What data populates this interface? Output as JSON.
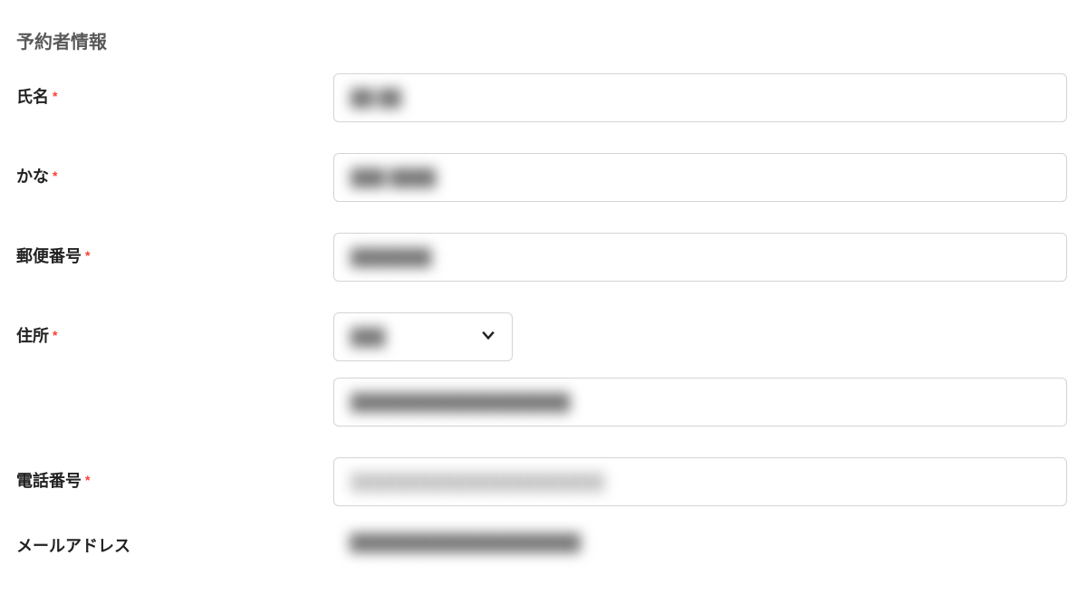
{
  "section": {
    "title": "予約者情報"
  },
  "fields": {
    "name": {
      "label": "氏名",
      "required": true,
      "value": "██ ██"
    },
    "kana": {
      "label": "かな",
      "required": true,
      "value": "███ ████"
    },
    "postal": {
      "label": "郵便番号",
      "required": true,
      "value": "███████"
    },
    "address": {
      "label": "住所",
      "required": true,
      "prefecture": "███",
      "detail": "███████████████████"
    },
    "phone": {
      "label": "電話番号",
      "required": true,
      "value": "██████████████████████"
    },
    "email": {
      "label": "メールアドレス",
      "required": false,
      "value": "████████████████████"
    }
  }
}
